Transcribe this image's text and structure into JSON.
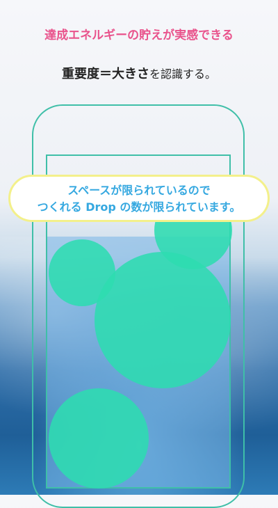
{
  "headline": "達成エネルギーの貯えが実感できる",
  "subline": {
    "bold": "重要度＝大きさ",
    "rest": "を認識する。"
  },
  "callout": {
    "line1": "スペースが限られているので",
    "line2": "つくれる Drop の数が限られています。"
  },
  "colors": {
    "headline": "#e9538c",
    "outline": "#3fbfa8",
    "drop": "#2ddcb0",
    "callout_text": "#35a8e0",
    "callout_border": "#f3f08b"
  }
}
